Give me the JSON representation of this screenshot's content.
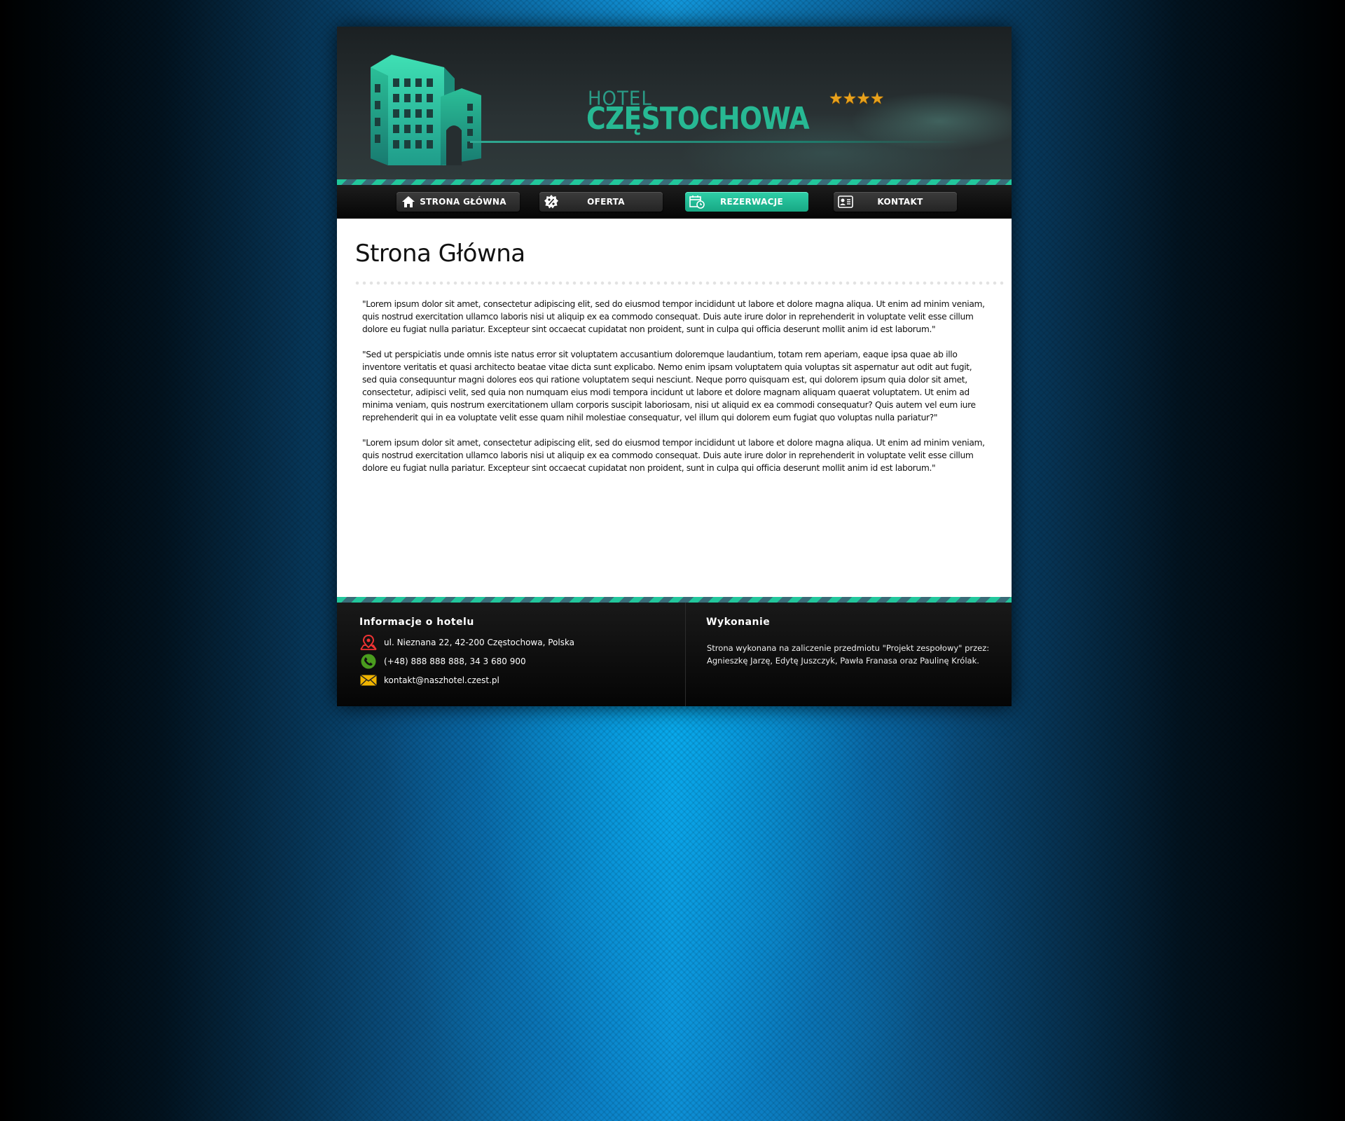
{
  "brand": {
    "hotel": "HOTEL",
    "city": "CZĘSTOCHOWA",
    "stars": "★★★★"
  },
  "nav": [
    {
      "label": "STRONA GŁÓWNA",
      "icon": "home-icon"
    },
    {
      "label": "OFERTA",
      "icon": "percent-badge-icon"
    },
    {
      "label": "REZERWACJE",
      "icon": "calendar-clock-icon"
    },
    {
      "label": "KONTAKT",
      "icon": "contact-card-icon"
    }
  ],
  "main": {
    "title": "Strona Główna",
    "paragraphs": [
      "\"Lorem ipsum dolor sit amet, consectetur adipiscing elit, sed do eiusmod tempor incididunt ut labore et dolore magna aliqua. Ut enim ad minim veniam, quis nostrud exercitation ullamco laboris nisi ut aliquip ex ea commodo consequat. Duis aute irure dolor in reprehenderit in voluptate velit esse cillum dolore eu fugiat nulla pariatur. Excepteur sint occaecat cupidatat non proident, sunt in culpa qui officia deserunt mollit anim id est laborum.\"",
      "\"Sed ut perspiciatis unde omnis iste natus error sit voluptatem accusantium doloremque laudantium, totam rem aperiam, eaque ipsa quae ab illo inventore veritatis et quasi architecto beatae vitae dicta sunt explicabo. Nemo enim ipsam voluptatem quia voluptas sit aspernatur aut odit aut fugit, sed quia consequuntur magni dolores eos qui ratione voluptatem sequi nesciunt. Neque porro quisquam est, qui dolorem ipsum quia dolor sit amet, consectetur, adipisci velit, sed quia non numquam eius modi tempora incidunt ut labore et dolore magnam aliquam quaerat voluptatem. Ut enim ad minima veniam, quis nostrum exercitationem ullam corporis suscipit laboriosam, nisi ut aliquid ex ea commodi consequatur? Quis autem vel eum iure reprehenderit qui in ea voluptate velit esse quam nihil molestiae consequatur, vel illum qui dolorem eum fugiat quo voluptas nulla pariatur?\"",
      "\"Lorem ipsum dolor sit amet, consectetur adipiscing elit, sed do eiusmod tempor incididunt ut labore et dolore magna aliqua. Ut enim ad minim veniam, quis nostrud exercitation ullamco laboris nisi ut aliquip ex ea commodo consequat. Duis aute irure dolor in reprehenderit in voluptate velit esse cillum dolore eu fugiat nulla pariatur. Excepteur sint occaecat cupidatat non proident, sunt in culpa qui officia deserunt mollit anim id est laborum.\""
    ]
  },
  "footer": {
    "info_title": "Informacje o hotelu",
    "address": "ul. Nieznana 22, 42-200 Częstochowa, Polska",
    "phone": "(+48) 888 888 888, 34 3 680 900",
    "email": "kontakt@naszhotel.czest.pl",
    "credits_title": "Wykonanie",
    "credits_text": "Strona wykonana na zaliczenie przedmiotu \"Projekt zespołowy\" przez: Agnieszkę Jarzę, Edytę Juszczyk, Pawła Franasa oraz Paulinę Królak."
  },
  "colors": {
    "accent": "#22c79c",
    "nav_active": "#1fbf97",
    "background": "#0f86c9",
    "star": "#e8a11c"
  }
}
